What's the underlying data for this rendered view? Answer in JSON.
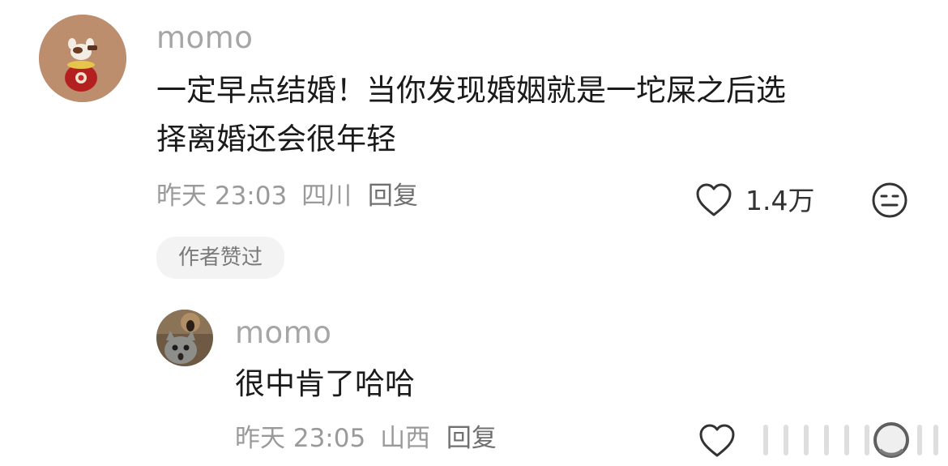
{
  "comment": {
    "username": "momo",
    "text_line1": "一定早点结婚！当你发现婚姻就是一坨屎之后选",
    "text_line2": "择离婚还会很年轻",
    "time": "昨天 23:03",
    "location": "四川",
    "reply_label": "回复",
    "like_count": "1.4万",
    "badge": "作者赞过"
  },
  "reply": {
    "username": "momo",
    "text": "很中肯了哈哈",
    "time": "昨天 23:05",
    "location": "山西",
    "reply_label": "回复"
  },
  "icons": {
    "like": "heart-outline-icon",
    "dislike": "neutral-face-icon",
    "watermark": "weibo-watermark"
  }
}
